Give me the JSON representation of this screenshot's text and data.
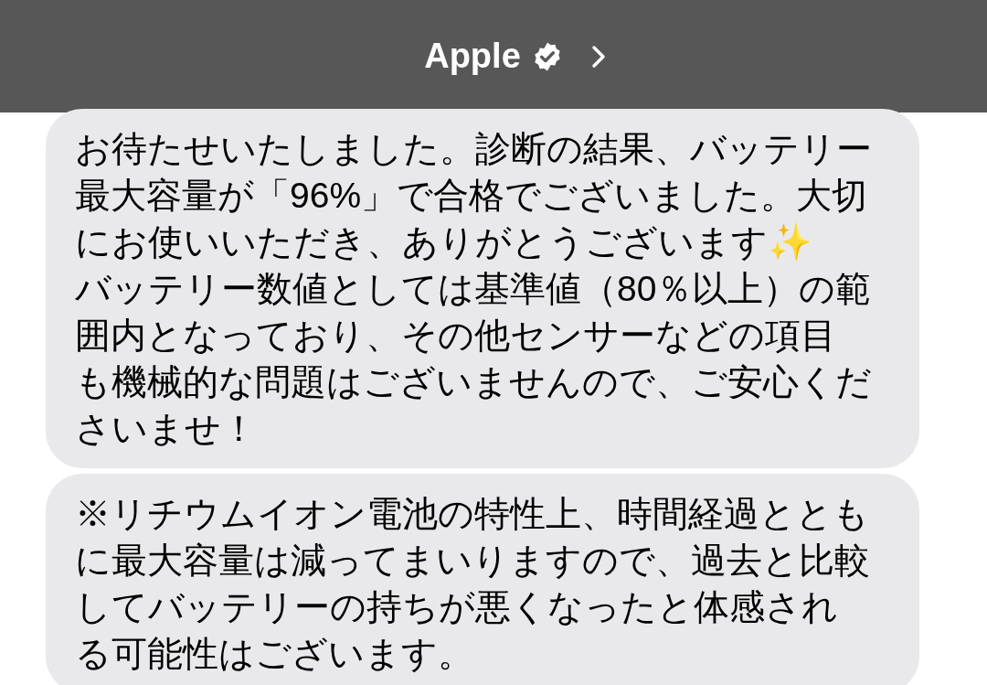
{
  "header": {
    "title": "Apple",
    "verified": true
  },
  "messages": [
    {
      "text": "お待たせいたしました。診断の結果、バッテリー最大容量が「96%」で合格でございました。大切にお使いいただき、ありがとうございます✨\nバッテリー数値としては基準値（80％以上）の範囲内となっており、その他センサーなどの項目も機械的な問題はございませんので、ご安心くださいませ！"
    },
    {
      "text": "※リチウムイオン電池の特性上、時間経過とともに最大容量は減ってまいりますので、過去と比較してバッテリーの持ちが悪くなったと体感される可能性はございます。"
    }
  ]
}
